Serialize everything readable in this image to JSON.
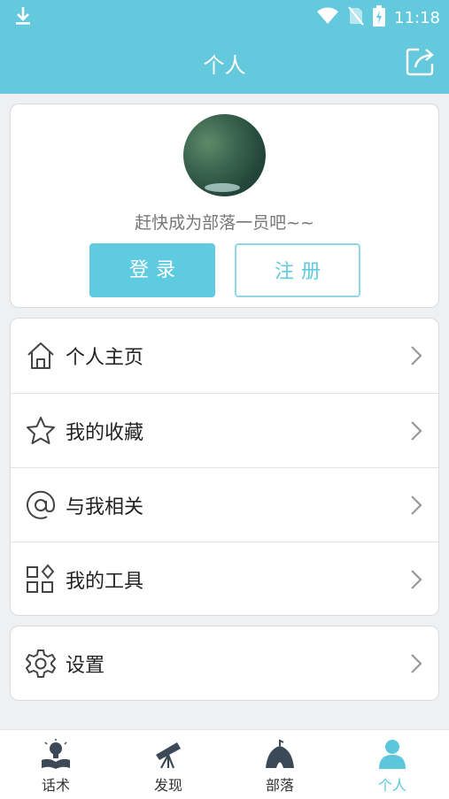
{
  "status_bar": {
    "time": "11:18"
  },
  "header": {
    "title": "个人"
  },
  "profile": {
    "tagline": "赶快成为部落一员吧~~",
    "login_label": "登录",
    "register_label": "注册"
  },
  "menu": {
    "items": [
      {
        "label": "个人主页",
        "icon": "home-icon"
      },
      {
        "label": "我的收藏",
        "icon": "star-icon"
      },
      {
        "label": "与我相关",
        "icon": "at-icon"
      },
      {
        "label": "我的工具",
        "icon": "tools-icon"
      }
    ]
  },
  "settings": {
    "label": "设置",
    "icon": "gear-icon"
  },
  "tabs": [
    {
      "label": "话术",
      "icon": "book-bulb-icon"
    },
    {
      "label": "发现",
      "icon": "telescope-icon"
    },
    {
      "label": "部落",
      "icon": "tent-icon"
    },
    {
      "label": "个人",
      "icon": "person-icon",
      "active": true
    }
  ],
  "colors": {
    "accent": "#64c9dc",
    "button": "#5fcbe0",
    "background": "#eef0f2"
  }
}
